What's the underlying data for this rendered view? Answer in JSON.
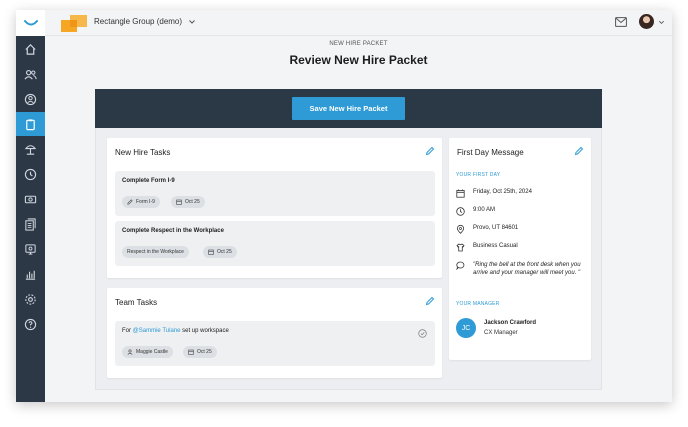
{
  "topbar": {
    "org_name": "Rectangle Group (demo)",
    "icons": [
      "mail-icon",
      "user-avatar",
      "chevron-down-icon"
    ]
  },
  "sidebar": {
    "items": [
      {
        "icon": "home-icon",
        "active": false
      },
      {
        "icon": "people-icon",
        "active": false
      },
      {
        "icon": "person-search-icon",
        "active": false
      },
      {
        "icon": "clipboard-icon",
        "active": true
      },
      {
        "icon": "beach-icon",
        "active": false
      },
      {
        "icon": "clock-icon",
        "active": false
      },
      {
        "icon": "money-icon",
        "active": false
      },
      {
        "icon": "documents-icon",
        "active": false
      },
      {
        "icon": "performance-icon",
        "active": false
      },
      {
        "icon": "reports-icon",
        "active": false
      },
      {
        "icon": "settings-icon",
        "active": false
      },
      {
        "icon": "help-icon",
        "active": false
      }
    ]
  },
  "header": {
    "eyebrow": "NEW HIRE PACKET",
    "title": "Review New Hire Packet"
  },
  "banner": {
    "save_label": "Save New Hire Packet"
  },
  "new_hire_tasks": {
    "title": "New Hire Tasks",
    "tasks": [
      {
        "title": "Complete Form I-9",
        "chip": "Form I-9",
        "date": "Oct 25"
      },
      {
        "title": "Complete Respect in the Workplace",
        "chip": "Respect in the Workplace",
        "date": "Oct 25"
      }
    ]
  },
  "team_tasks": {
    "title": "Team Tasks",
    "task": {
      "prefix": "For",
      "mention": "@Sammie Tulane",
      "suffix": "set up workspace",
      "assignee": "Maggie Castle",
      "date": "Oct 25"
    }
  },
  "first_day": {
    "title": "First Day Message",
    "your_first_day_label": "YOUR FIRST DAY",
    "date": "Friday, Oct 25th, 2024",
    "time": "9:00 AM",
    "location": "Provo, UT 84601",
    "dress": "Business Casual",
    "message": "\"Ring the bell at the front desk when you arrive and your manager will meet you. \"",
    "your_manager_label": "YOUR MANAGER",
    "manager_initials": "JC",
    "manager_name": "Jackson Crawford",
    "manager_title": "CX Manager"
  },
  "colors": {
    "accent": "#2e9bd6",
    "sidebar": "#2c3846",
    "banner": "#2b3947",
    "logo_orange": "#f5a623"
  }
}
